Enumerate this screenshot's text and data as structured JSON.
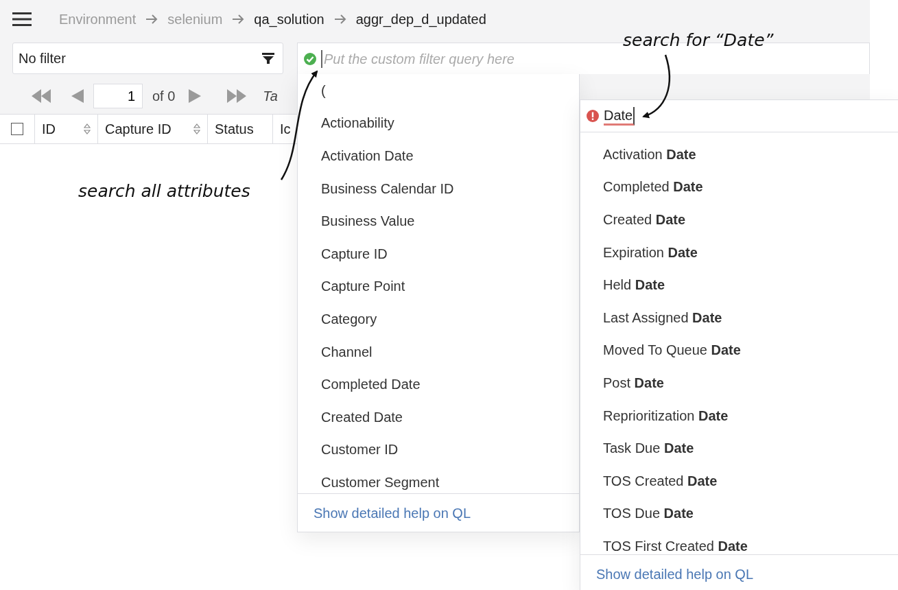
{
  "breadcrumb": [
    {
      "label": "Environment",
      "dimmed": true
    },
    {
      "label": "selenium",
      "dimmed": true
    },
    {
      "label": "qa_solution",
      "dimmed": false
    },
    {
      "label": "aggr_dep_d_updated",
      "dimmed": false
    }
  ],
  "filter_select": {
    "value": "No filter"
  },
  "query_field": {
    "placeholder": "Put the custom filter query here",
    "valid": true
  },
  "pager": {
    "page": "1",
    "of": "of 0",
    "label": "Ta"
  },
  "table": {
    "select_all": {
      "checked": false
    },
    "columns": [
      {
        "label": "ID",
        "sortable": true
      },
      {
        "label": "Capture ID",
        "sortable": true
      },
      {
        "label": "Status",
        "sortable": false
      },
      {
        "label": "Ic",
        "sortable": false
      }
    ]
  },
  "attribute_menu": {
    "items": [
      "(",
      "Actionability",
      "Activation Date",
      "Business Calendar ID",
      "Business Value",
      "Capture ID",
      "Capture Point",
      "Category",
      "Channel",
      "Completed Date",
      "Created Date",
      "Customer ID",
      "Customer Segment"
    ],
    "help_link": "Show detailed help on QL"
  },
  "search_menu": {
    "value": "Date",
    "valid": false,
    "items": [
      "Activation **Date**",
      "Completed **Date**",
      "Created **Date**",
      "Expiration **Date**",
      "Held **Date**",
      "Last Assigned **Date**",
      "Moved To Queue **Date**",
      "Post **Date**",
      "Reprioritization **Date**",
      "Task Due **Date**",
      "TOS Created **Date**",
      "TOS Due **Date**",
      "TOS First Created **Date**"
    ],
    "help_link": "Show detailed help on QL"
  },
  "annotations": [
    {
      "text": "search all attributes"
    },
    {
      "text": "search for “Date”"
    }
  ]
}
